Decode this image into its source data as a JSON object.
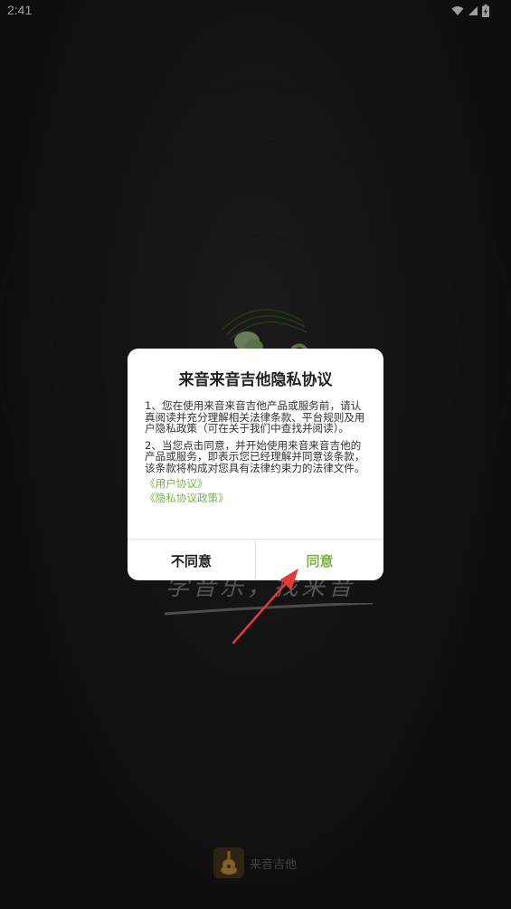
{
  "status_bar": {
    "time": "2:41",
    "icons": [
      "wifi-icon",
      "cell-signal-icon",
      "battery-icon"
    ]
  },
  "background": {
    "slogan": "学音乐，找来音",
    "brand_name": "来音吉他"
  },
  "dialog": {
    "title": "来音来音吉他隐私协议",
    "paragraph_1": "1、您在使用来音来音吉他产品或服务前，请认真阅读并充分理解相关法律条款、平台规则及用户隐私政策（可在关于我们中查找并阅读）。",
    "paragraph_2": "2、当您点击同意，并开始使用来音来音吉他的产品或服务，即表示您已经理解并同意该条款，该条款将构成对您具有法律约束力的法律文件。",
    "links": {
      "user_agreement": "《用户协议》",
      "privacy_policy": "《隐私协议政策》"
    },
    "buttons": {
      "disagree": "不同意",
      "agree": "同意"
    }
  },
  "colors": {
    "accent": "#7cb342",
    "annotation_arrow": "#e53935",
    "background": "#1a1a1a"
  }
}
